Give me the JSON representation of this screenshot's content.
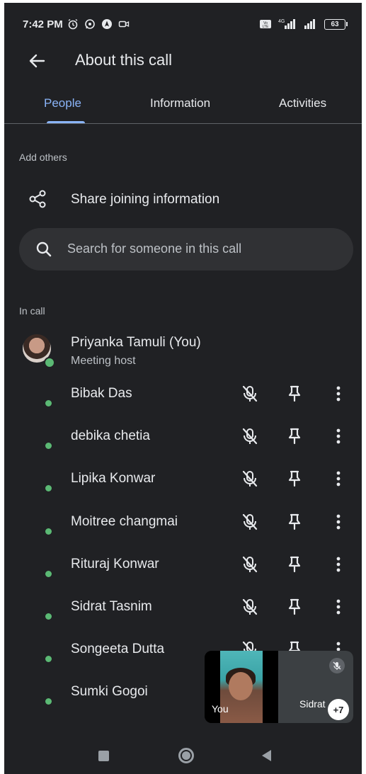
{
  "status_bar": {
    "time": "7:42 PM",
    "left_icons": [
      "alarm-icon",
      "whatsapp-icon",
      "navigation-icon",
      "video-camera-icon"
    ],
    "right_icons": [
      "volte-icon",
      "signal-4g-icon",
      "signal-icon"
    ],
    "network_label": "4G",
    "battery": "63"
  },
  "app_bar": {
    "title": "About this call",
    "back_icon": "arrow-left-icon"
  },
  "tabs": [
    {
      "label": "People",
      "active": true
    },
    {
      "label": "Information",
      "active": false
    },
    {
      "label": "Activities",
      "active": false
    }
  ],
  "add_others": {
    "label": "Add others",
    "share_label": "Share joining information",
    "share_icon": "share-icon"
  },
  "search": {
    "placeholder": "Search for someone in this call"
  },
  "in_call": {
    "label": "In call",
    "host": {
      "name": "Priyanka Tamuli (You)",
      "role": "Meeting host"
    },
    "participants": [
      {
        "name": "Bibak Das"
      },
      {
        "name": "debika chetia"
      },
      {
        "name": "Lipika Konwar"
      },
      {
        "name": "Moitree changmai"
      },
      {
        "name": "Rituraj Konwar"
      },
      {
        "name": "Sidrat Tasnim"
      },
      {
        "name": "Songeeta Dutta"
      },
      {
        "name": "Sumki Gogoi"
      }
    ]
  },
  "pip": {
    "self_label": "You",
    "other_label": "Sidrat",
    "more_count": "+7"
  },
  "colors": {
    "background": "#202124",
    "accent": "#8ab4f8",
    "online": "#5bb974"
  },
  "nav_bar": [
    "recents-icon",
    "home-icon",
    "back-icon"
  ]
}
